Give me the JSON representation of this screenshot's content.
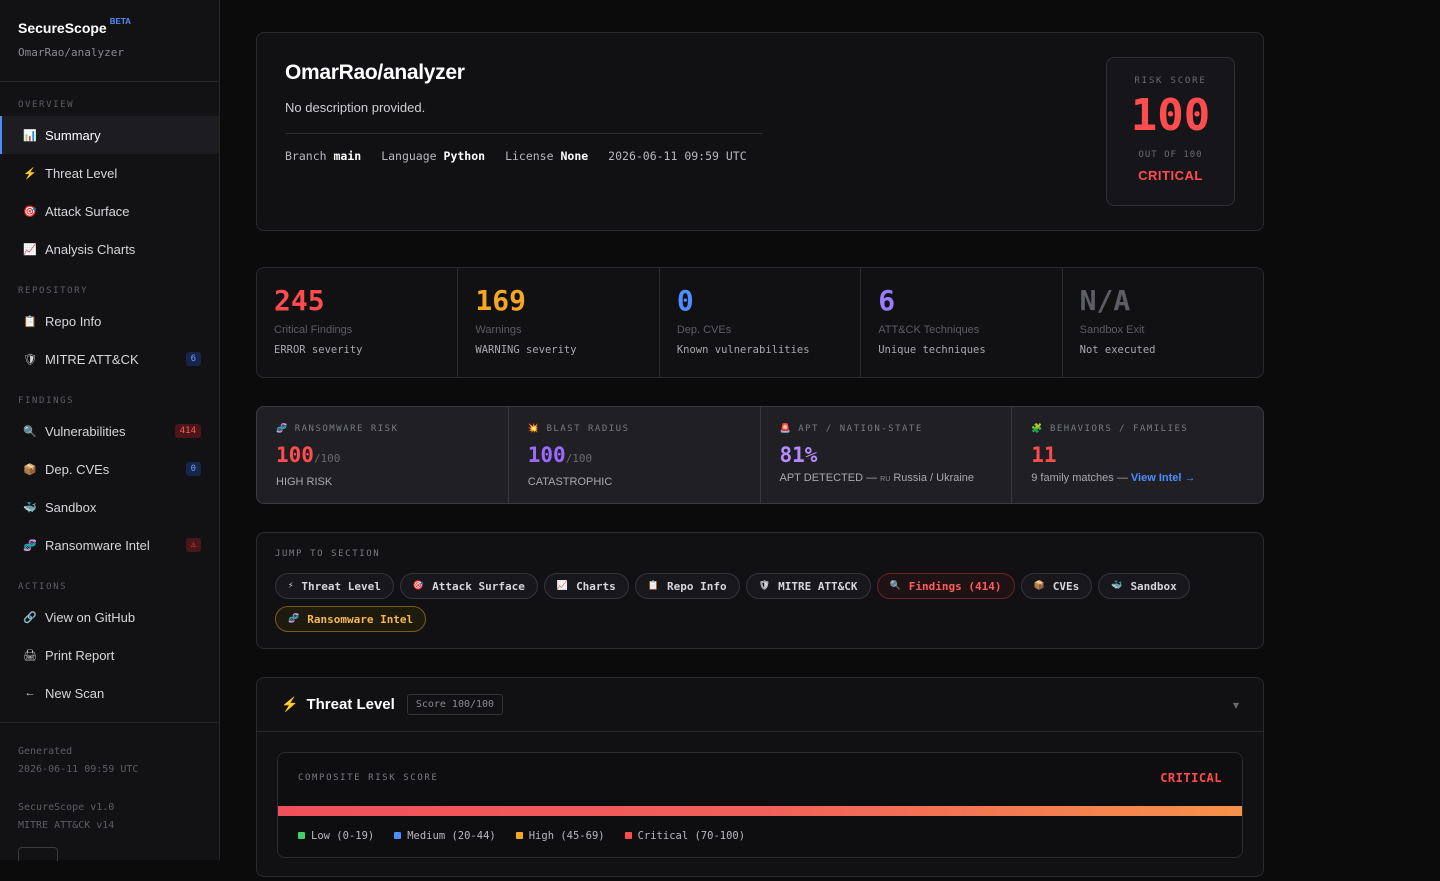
{
  "colors": {
    "accent": "#4f8cff",
    "critical": "#ff4d4f",
    "warning": "#f5a623",
    "info": "#4f8cff",
    "purple": "#9b7bff",
    "muted": "#5d5d66"
  },
  "sidebar": {
    "brand": "SecureScope",
    "beta": "BETA",
    "repo": "OmarRao/analyzer",
    "sections": [
      {
        "title": "OVERVIEW",
        "items": [
          {
            "label": "Summary",
            "icon": "bar-chart-icon",
            "glyph": "📊",
            "active": true
          },
          {
            "label": "Threat Level",
            "icon": "lightning-icon",
            "glyph": "⚡"
          },
          {
            "label": "Attack Surface",
            "icon": "target-icon",
            "glyph": "🎯"
          },
          {
            "label": "Analysis Charts",
            "icon": "line-chart-icon",
            "glyph": "📈"
          }
        ]
      },
      {
        "title": "REPOSITORY",
        "items": [
          {
            "label": "Repo Info",
            "icon": "clipboard-icon",
            "glyph": "📋"
          },
          {
            "label": "MITRE ATT&CK",
            "icon": "shield-icon",
            "glyph": "🛡",
            "badge": "6",
            "badge_color": "blue"
          }
        ]
      },
      {
        "title": "FINDINGS",
        "items": [
          {
            "label": "Vulnerabilities",
            "icon": "magnifier-icon",
            "glyph": "🔍",
            "badge": "414",
            "badge_color": "red"
          },
          {
            "label": "Dep. CVEs",
            "icon": "package-icon",
            "glyph": "📦",
            "badge": "0",
            "badge_color": "blue"
          },
          {
            "label": "Sandbox",
            "icon": "whale-icon",
            "glyph": "🐳"
          },
          {
            "label": "Ransomware Intel",
            "icon": "dna-icon",
            "glyph": "🧬",
            "badge": "⚠",
            "badge_color": "red"
          }
        ]
      },
      {
        "title": "ACTIONS",
        "items": [
          {
            "label": "View on GitHub",
            "icon": "link-icon",
            "glyph": "🔗"
          },
          {
            "label": "Print Report",
            "icon": "printer-icon",
            "glyph": "🖨"
          },
          {
            "label": "New Scan",
            "icon": "arrow-left-icon",
            "glyph": "←"
          }
        ]
      }
    ],
    "footer": {
      "generated_label": "Generated",
      "generated_at": "2026-06-11 09:59 UTC",
      "version": "SecureScope v1.0",
      "mitre": "MITRE ATT&CK v14"
    }
  },
  "hero": {
    "title": "OmarRao/analyzer",
    "description": "No description provided.",
    "branch_label": "Branch",
    "branch": "main",
    "language_label": "Language",
    "language": "Python",
    "license_label": "License",
    "license": "None",
    "timestamp": "2026-06-11 09:59 UTC",
    "risk_label": "RISK SCORE",
    "risk_value": "100",
    "risk_of": "OUT OF 100",
    "risk_level": "CRITICAL"
  },
  "stats": [
    {
      "value": "245",
      "label": "Critical Findings",
      "sub": "ERROR severity",
      "color": "#ff4d4f"
    },
    {
      "value": "169",
      "label": "Warnings",
      "sub": "WARNING severity",
      "color": "#f5a623"
    },
    {
      "value": "0",
      "label": "Dep. CVEs",
      "sub": "Known vulnerabilities",
      "color": "#4f8cff"
    },
    {
      "value": "6",
      "label": "ATT&CK Techniques",
      "sub": "Unique techniques",
      "color": "#9b7bff"
    },
    {
      "value": "N/A",
      "label": "Sandbox Exit",
      "sub": "Not executed",
      "color": "#5d5d66"
    }
  ],
  "threats": [
    {
      "label": "RANSOMWARE RISK",
      "glyph": "🧬",
      "icon": "dna-icon",
      "value": "100",
      "suffix": "/100",
      "note": "HIGH RISK",
      "color": "#ff4d4f"
    },
    {
      "label": "BLAST RADIUS",
      "glyph": "💥",
      "icon": "explosion-icon",
      "value": "100",
      "suffix": "/100",
      "note": "CATASTROPHIC",
      "color": "#9b6bff"
    },
    {
      "label": "APT / NATION-STATE",
      "glyph": "🚨",
      "icon": "siren-icon",
      "value": "81%",
      "suffix": "",
      "note_prefix": "APT DETECTED — ",
      "note_cc": "RU",
      "note_suffix": " Russia / Ukraine",
      "color": "#b58cff"
    },
    {
      "label": "BEHAVIORS / FAMILIES",
      "glyph": "🧩",
      "icon": "puzzle-icon",
      "value": "11",
      "suffix": "",
      "note_prefix": "9 family matches — ",
      "link": "View Intel →",
      "color": "#ff4d4f"
    }
  ],
  "jump": {
    "title": "JUMP TO SECTION",
    "pills": [
      {
        "label": "Threat Level",
        "glyph": "⚡",
        "icon": "lightning-icon"
      },
      {
        "label": "Attack Surface",
        "glyph": "🎯",
        "icon": "target-icon"
      },
      {
        "label": "Charts",
        "glyph": "📈",
        "icon": "line-chart-icon"
      },
      {
        "label": "Repo Info",
        "glyph": "📋",
        "icon": "clipboard-icon"
      },
      {
        "label": "MITRE ATT&CK",
        "glyph": "🛡",
        "icon": "shield-icon"
      },
      {
        "label": "Findings (414)",
        "glyph": "🔍",
        "icon": "magnifier-icon",
        "style": "red"
      },
      {
        "label": "CVEs",
        "glyph": "📦",
        "icon": "package-icon"
      },
      {
        "label": "Sandbox",
        "glyph": "🐳",
        "icon": "whale-icon"
      },
      {
        "label": "Ransomware Intel",
        "glyph": "🧬",
        "icon": "dna-icon",
        "style": "amber"
      }
    ]
  },
  "threat_level": {
    "title": "Threat Level",
    "score_badge": "Score 100/100",
    "composite_label": "COMPOSITE RISK SCORE",
    "composite_level": "CRITICAL",
    "composite_fill": 1.0,
    "legend": [
      {
        "label": "Low (0-19)",
        "color": "#3ecf6a"
      },
      {
        "label": "Medium (20-44)",
        "color": "#4f8cff"
      },
      {
        "label": "High (45-69)",
        "color": "#f5a623"
      },
      {
        "label": "Critical (70-100)",
        "color": "#ff4d4f"
      }
    ]
  }
}
